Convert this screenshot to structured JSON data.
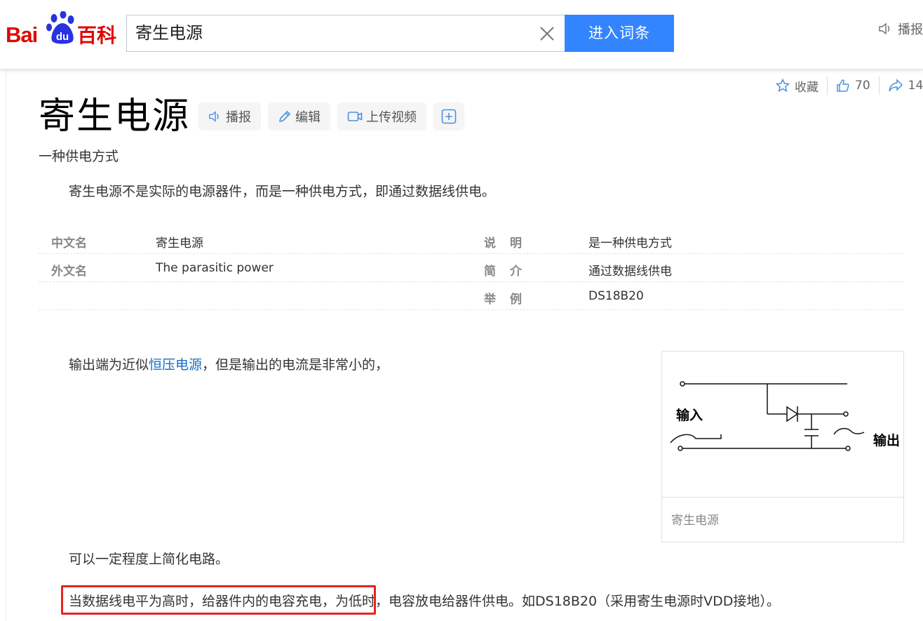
{
  "header": {
    "logo_text_left": "Bai",
    "logo_text_paw": "du",
    "logo_text_right": "百科",
    "search_value": "寄生电源",
    "enter_button": "进入词条",
    "play_label": "播报"
  },
  "top_actions": {
    "collect_label": "收藏",
    "like_count": "70",
    "share_count": "14"
  },
  "entry": {
    "title": "寄生电源",
    "buttons": {
      "play": "播报",
      "edit": "编辑",
      "upload_video": "上传视频"
    },
    "subtitle": "一种供电方式",
    "summary": "寄生电源不是实际的电源器件，而是一种供电方式，即通过数据线供电。"
  },
  "info_table": [
    {
      "k1": "中文名",
      "v1": "寄生电源",
      "k2": "说明",
      "v2": "是一种供电方式"
    },
    {
      "k1": "外文名",
      "v1": "The parasitic power",
      "k2": "简介",
      "v2": "通过数据线供电"
    },
    {
      "k1": "",
      "v1": "",
      "k2": "举例",
      "v2": "DS18B20"
    }
  ],
  "body": {
    "p1_before": "输出端为近似",
    "p1_link": "恒压电源",
    "p1_after": "，但是输出的电流是非常小的，",
    "p2": "可以一定程度上简化电路。",
    "p3": "当数据线电平为高时，给器件内的电容充电，为低时，电容放电给器件供电。如DS18B20（采用寄生电源时VDD接地）。"
  },
  "figure": {
    "label_input": "输入",
    "label_output": "输出",
    "caption": "寄生电源"
  },
  "colors": {
    "brand_red": "#e10601",
    "brand_blue": "#2932e1",
    "button_blue": "#3385ff",
    "link_blue": "#136ec2",
    "highlight_red": "#e8231c"
  }
}
